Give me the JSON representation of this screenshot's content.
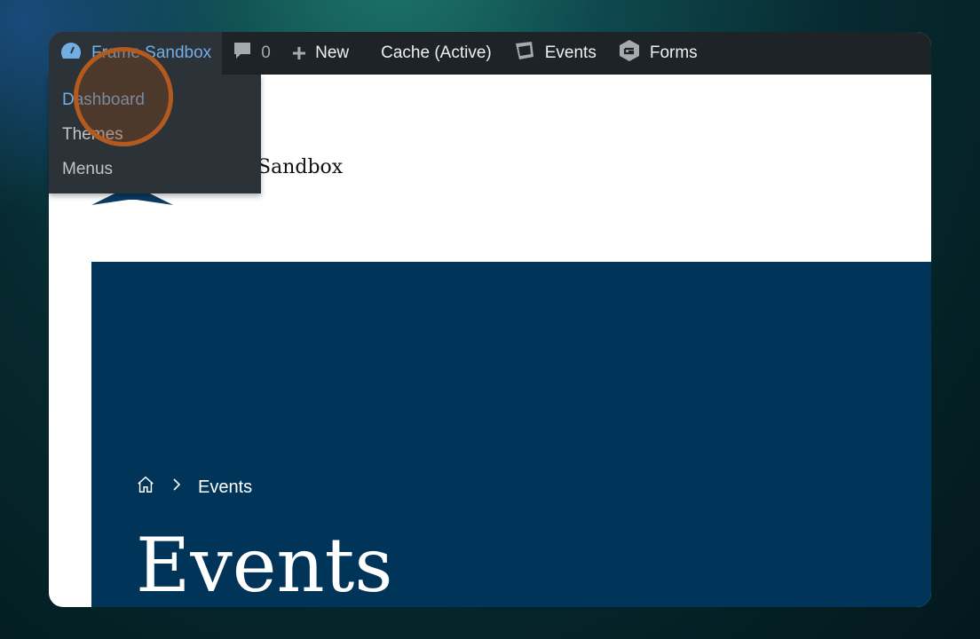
{
  "adminbar": {
    "site": "Frame Sandbox",
    "comments": "0",
    "new": "New",
    "cache": "Cache (Active)",
    "events": "Events",
    "forms": "Forms"
  },
  "dropdown": [
    "Dashboard",
    "Themes",
    "Menus"
  ],
  "site": {
    "name": "Sandbox"
  },
  "breadcrumb": {
    "current": "Events"
  },
  "page": {
    "title": "Events"
  }
}
